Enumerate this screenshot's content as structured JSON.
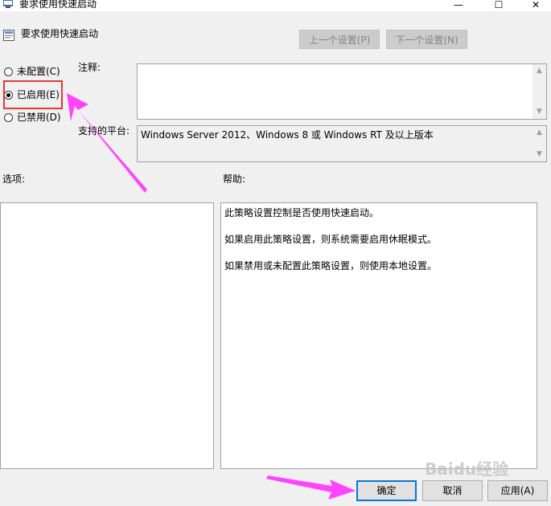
{
  "window": {
    "title": "要求使用快速启动",
    "minimize_glyph": "—",
    "maximize_glyph": "☐",
    "close_glyph": "✕"
  },
  "header": {
    "policy_name": "要求使用快速启动",
    "prev_setting": "上一个设置(P)",
    "next_setting": "下一个设置(N)"
  },
  "state": {
    "options": [
      {
        "label": "未配置(C)",
        "selected": false
      },
      {
        "label": "已启用(E)",
        "selected": true
      },
      {
        "label": "已禁用(D)",
        "selected": false
      }
    ]
  },
  "comment": {
    "label": "注释:",
    "value": ""
  },
  "supported": {
    "label": "支持的平台:",
    "value": "Windows Server 2012、Windows 8 或 Windows RT 及以上版本"
  },
  "options_panel": {
    "label": "选项:"
  },
  "help": {
    "label": "帮助:",
    "lines": [
      "此策略设置控制是否使用快速启动。",
      "如果启用此策略设置，则系统需要启用休眠模式。",
      "如果禁用或未配置此策略设置，则使用本地设置。"
    ]
  },
  "buttons": {
    "ok": "确定",
    "cancel": "取消",
    "apply": "应用(A)"
  },
  "annotation": {
    "accent_color": "#ff44ff",
    "highlight_color": "#e53935"
  },
  "watermark": {
    "text": "Baidu经验"
  }
}
